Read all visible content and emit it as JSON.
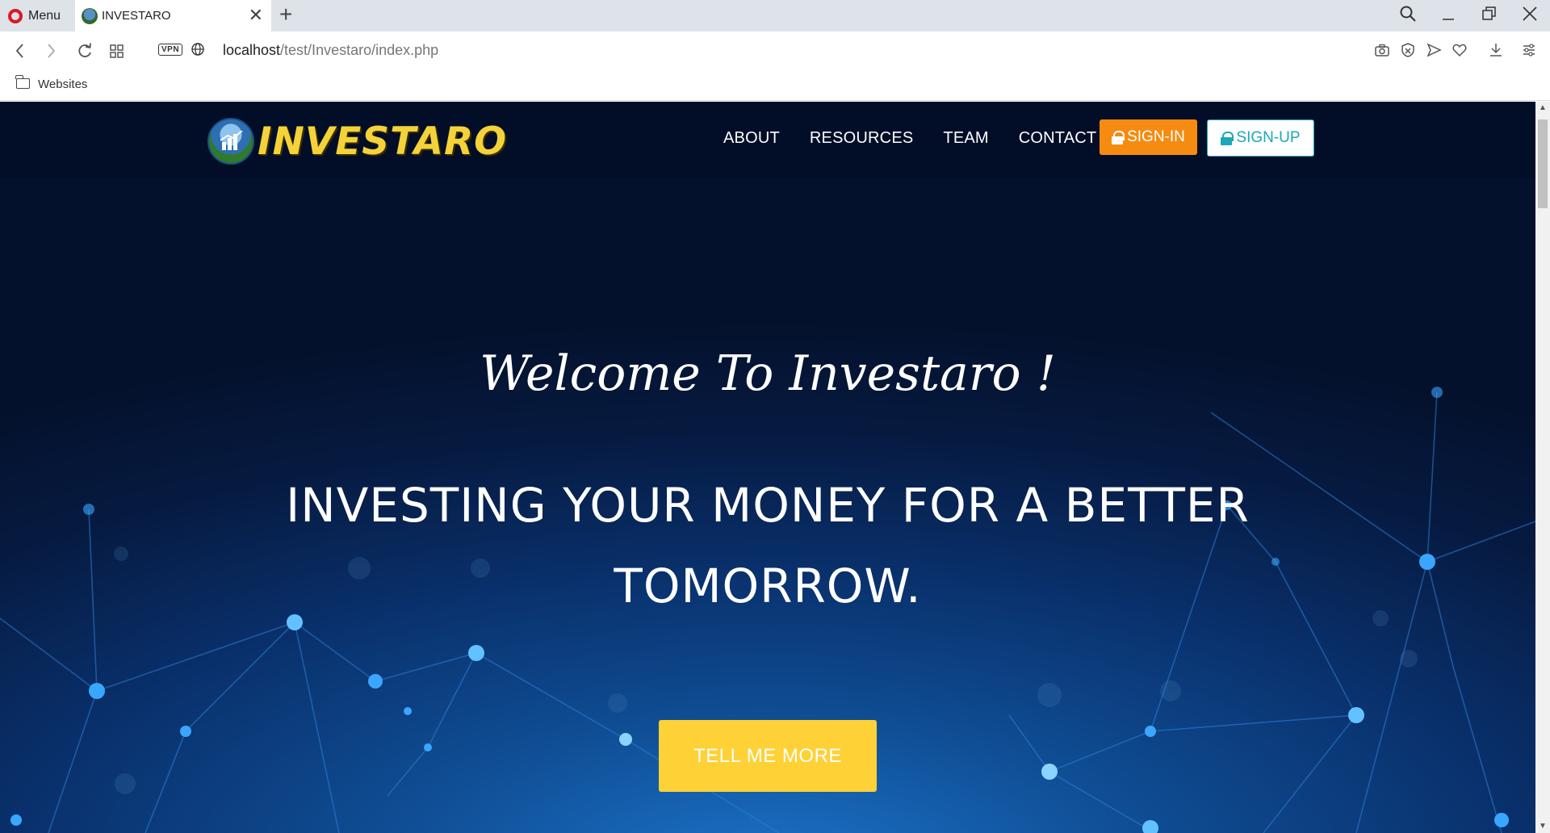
{
  "browser": {
    "menu_label": "Menu",
    "tab_title": "INVESTARO",
    "new_tab_symbol": "+",
    "url_host": "localhost",
    "url_path": "/test/Investaro/index.php",
    "vpn_label": "VPN",
    "bookmark_label": "Websites"
  },
  "site": {
    "logo_text": "INVESTARO",
    "nav": [
      "ABOUT",
      "RESOURCES",
      "TEAM",
      "CONTACT"
    ],
    "signin_label": "SIGN-IN",
    "signup_label": "SIGN-UP",
    "welcome": "Welcome To Investaro !",
    "headline": "INVESTING YOUR MONEY FOR A BETTER TOMORROW.",
    "cta_label": "TELL ME MORE"
  },
  "colors": {
    "signin_bg": "#f58b11",
    "signup_text": "#1ba8b8",
    "cta_bg": "#fed136",
    "logo_text": "#f4d23a",
    "hero_bg": "#061a40"
  }
}
